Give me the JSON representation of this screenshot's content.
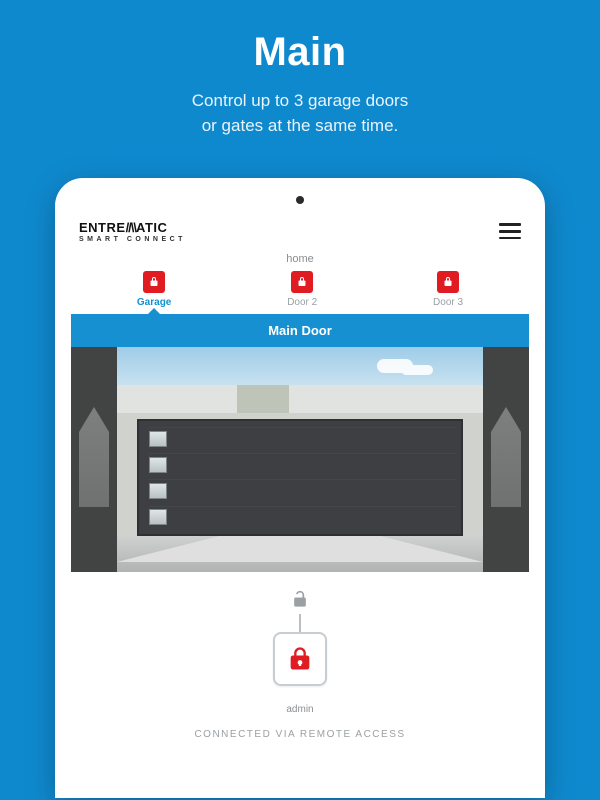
{
  "hero": {
    "title": "Main",
    "subtitle": "Control up to 3 garage doors\nor gates at the same time."
  },
  "brand": {
    "name_prefix": "ENTRE",
    "name_slash": "//\\\\",
    "name_suffix": "ATIC",
    "tagline": "SMART CONNECT"
  },
  "location": "home",
  "tabs": [
    {
      "label": "Garage",
      "active": true
    },
    {
      "label": "Door 2",
      "active": false
    },
    {
      "label": "Door 3",
      "active": false
    }
  ],
  "door_banner": "Main Door",
  "user_label": "admin",
  "connection_status": "CONNECTED VIA REMOTE ACCESS",
  "colors": {
    "page_bg": "#0f89ce",
    "accent": "#1690d0",
    "lock_red": "#e11b22"
  }
}
